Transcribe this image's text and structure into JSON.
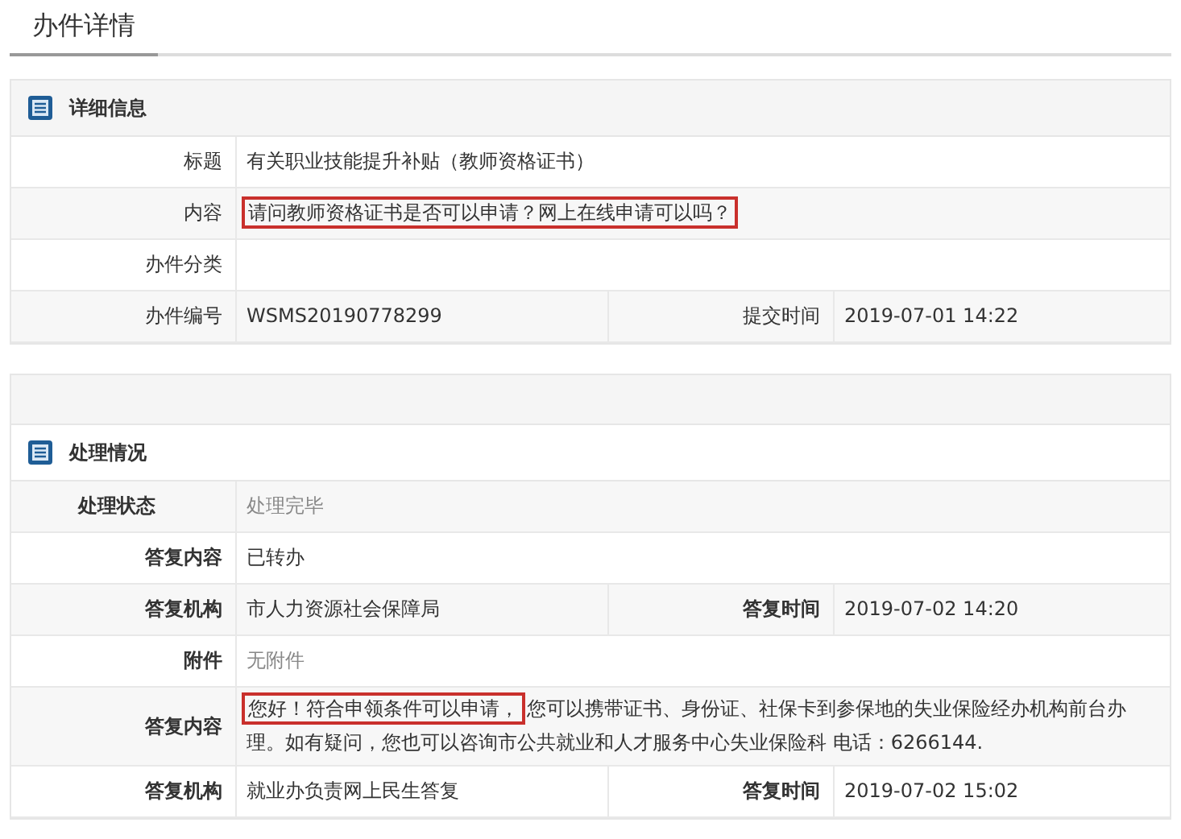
{
  "tabs": [
    {
      "label": "办件详情",
      "selected": true
    }
  ],
  "sections": [
    {
      "title": "详细信息",
      "kind": "details",
      "rows": [
        {
          "cells": [
            {
              "label": "标题",
              "parts": [
                {
                  "text": "有关职业技能提升补贴（教师资格证书）",
                  "highlighted": false
                }
              ]
            }
          ]
        },
        {
          "cells": [
            {
              "label": "内容",
              "parts": [
                {
                  "text": "请问教师资格证书是否可以申请？网上在线申请可以吗？",
                  "highlighted": true
                }
              ]
            }
          ]
        },
        {
          "cells": [
            {
              "label": "办件分类"
            }
          ]
        },
        {
          "cells": [
            {
              "label": "办件编号",
              "parts": [
                {
                  "text": "WSMS20190778299",
                  "highlighted": false
                }
              ]
            },
            {
              "label": "提交时间",
              "parts": [
                {
                  "text": "2019-07-01 14:22",
                  "highlighted": false
                }
              ]
            }
          ]
        }
      ]
    },
    {
      "title": "处理情况",
      "kind": "processing",
      "rows": [
        {
          "cells": [
            {
              "label": "处理状态",
              "muted": true,
              "parts": [
                {
                  "text": "处理完毕",
                  "highlighted": false
                }
              ]
            }
          ]
        },
        {
          "cells": [
            {
              "label": "答复内容",
              "muted": false,
              "parts": [
                {
                  "text": "已转办",
                  "highlighted": false
                }
              ]
            }
          ]
        },
        {
          "cells": [
            {
              "label": "答复机构",
              "muted": false,
              "parts": [
                {
                  "text": "市人力资源社会保障局",
                  "highlighted": false
                }
              ]
            },
            {
              "label": "答复时间",
              "muted": false,
              "parts": [
                {
                  "text": "2019-07-02 14:20",
                  "highlighted": false
                }
              ]
            }
          ]
        },
        {
          "cells": [
            {
              "label": "附件",
              "muted": true,
              "parts": [
                {
                  "text": "无附件",
                  "highlighted": false
                }
              ]
            }
          ]
        },
        {
          "cells": [
            {
              "label": "答复内容",
              "muted": false,
              "parts": [
                {
                  "text": "您好！符合申领条件可以申请，",
                  "highlighted": true
                },
                {
                  "text": "您可以携带证书、身份证、社保卡到参保地的失业保险经办机构前台办理。如有疑问，您也可以咨询市公共就业和人才服务中心失业保险科 电话：6266144.",
                  "highlighted": false
                }
              ]
            }
          ]
        },
        {
          "cells": [
            {
              "label": "答复机构",
              "muted": false,
              "parts": [
                {
                  "text": "就业办负责网上民生答复",
                  "highlighted": false
                }
              ]
            },
            {
              "label": "答复时间",
              "muted": false,
              "parts": [
                {
                  "text": "2019-07-02 15:02",
                  "highlighted": false
                }
              ]
            }
          ]
        }
      ]
    }
  ]
}
